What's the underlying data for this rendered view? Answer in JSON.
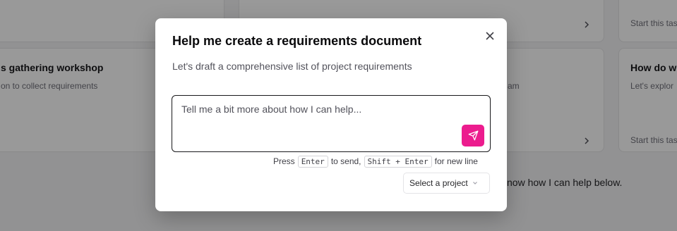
{
  "background": {
    "cards": [
      {
        "title": "",
        "description": "",
        "start": ""
      },
      {
        "title": "",
        "description": "",
        "start": "Start this tas"
      },
      {
        "title": "s gathering workshop",
        "description": "on to collect requirements",
        "start": ""
      },
      {
        "title": "",
        "description": "am",
        "start": ""
      },
      {
        "title": "How do w",
        "description": "Let's explor",
        "start": "Start this tas"
      }
    ],
    "helper_text": "now how I can help below."
  },
  "modal": {
    "title": "Help me create a requirements document",
    "subtitle": "Let's draft a comprehensive list of project requirements",
    "input": {
      "placeholder": "Tell me a bit more about how I can help...",
      "value": ""
    },
    "hint": {
      "press": "Press",
      "enter_key": "Enter",
      "to_send": "to send,",
      "shift_enter_key": "Shift + Enter",
      "new_line": "for new line"
    },
    "project_select": {
      "label": "Select a project"
    }
  },
  "colors": {
    "accent": "#ec1c8e",
    "overlay": "rgba(0,0,0,0.40)"
  },
  "icons": {
    "close": "close-icon",
    "send": "send-icon",
    "chevron_right": "chevron-right-icon",
    "chevron_down": "chevron-down-icon"
  }
}
